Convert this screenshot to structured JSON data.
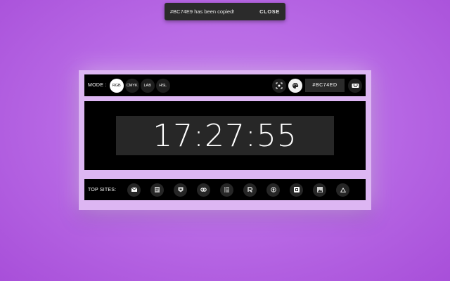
{
  "toast": {
    "message": "#BC74E9 has been copied!",
    "close_label": "CLOSE"
  },
  "mode": {
    "label": "MODE :",
    "options": [
      "RGB",
      "CMYK",
      "LAB",
      "HSL"
    ],
    "selected": "RGB"
  },
  "toolbar": {
    "hex_value": "#BC74ED",
    "icons": [
      "screenshot-icon",
      "palette-icon",
      "keyboard-icon"
    ]
  },
  "clock": {
    "time": "17:27:55"
  },
  "sites": {
    "label": "TOP SITES:",
    "icons": [
      "mail-icon",
      "document-icon",
      "shield-icon",
      "link-icon",
      "notebook-icon",
      "r-logo-icon",
      "github-icon",
      "square-logo-icon",
      "image-icon",
      "triangle-icon"
    ]
  },
  "colors": {
    "background": "#BC74E9",
    "frame": "#DDB6F3",
    "panel": "#000000",
    "toast": "#2B2B2B"
  }
}
